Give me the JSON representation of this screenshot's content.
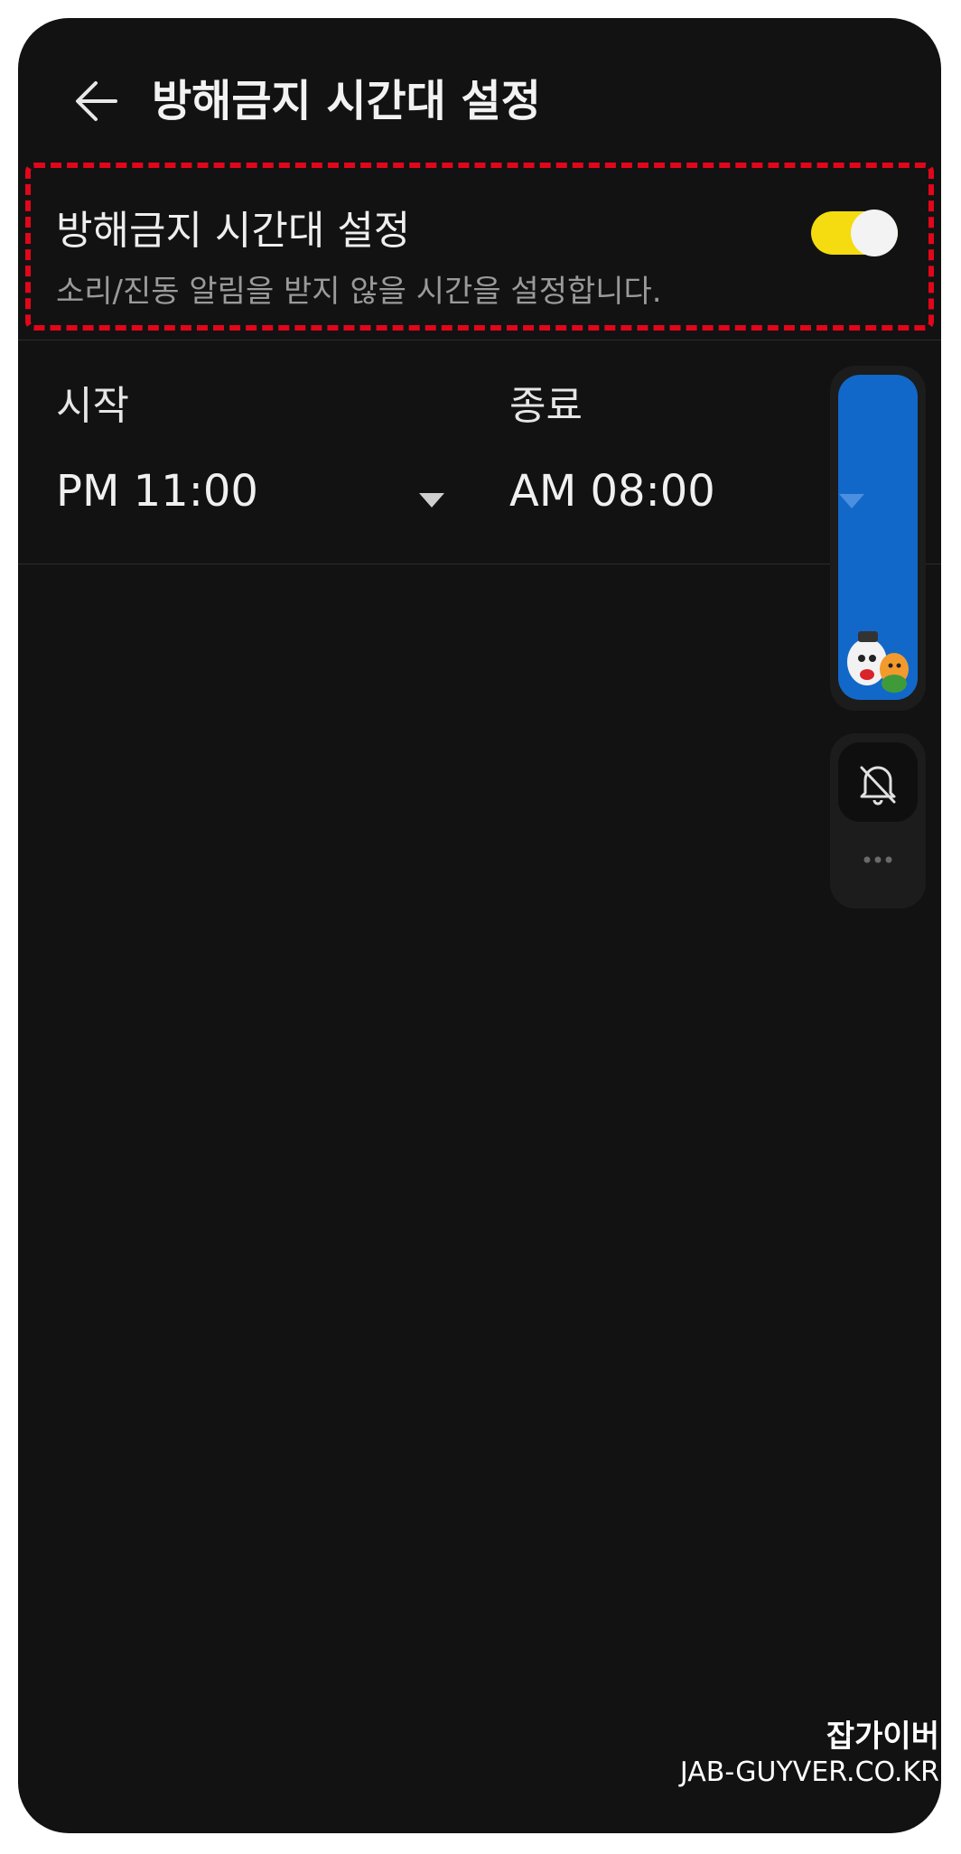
{
  "appbar": {
    "title": "방해금지 시간대 설정",
    "back_icon": "arrow-left-icon"
  },
  "setting": {
    "title": "방해금지 시간대 설정",
    "subtitle": "소리/진동 알림을 받지 않을 시간을 설정합니다.",
    "toggle_on": true,
    "toggle_color": "#f4dc10"
  },
  "time_range": {
    "start_label": "시작",
    "start_value": "PM 11:00",
    "end_label": "종료",
    "end_value": "AM 08:00"
  },
  "side_panel": {
    "volume_color": "#1268c8",
    "bell_icon": "bell-off-icon",
    "more_icon": "more-horizontal-icon"
  },
  "watermark": {
    "ko": "잡가이버",
    "en": "JAB-GUYVER.CO.KR"
  },
  "colors": {
    "background": "#121212",
    "highlight": "#e1061b"
  }
}
